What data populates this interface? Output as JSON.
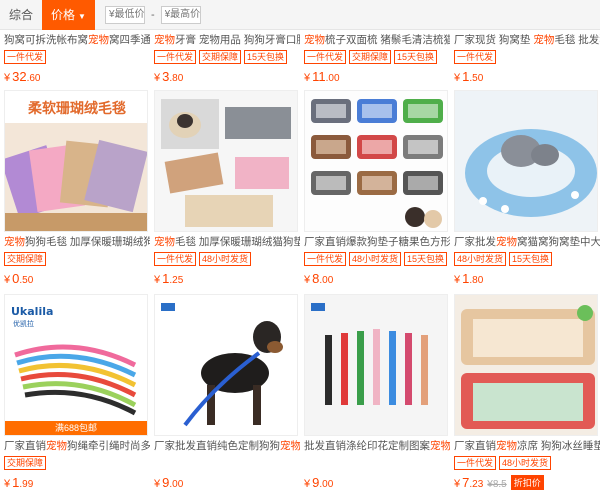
{
  "sortbar": {
    "comprehensive_label": "综合",
    "price_label": "价格",
    "price_arrow": "▼",
    "min_placeholder": "¥最低价",
    "max_placeholder": "¥最高价",
    "dash": "-"
  },
  "rows": [
    [
      {
        "title_pre": "狗窝可拆洗帐布窝",
        "title_hl": "宠物",
        "title_post": "窝四季通用厂家...",
        "tags": [
          "一件代发"
        ],
        "price_int": "32",
        "price_dec": ".60"
      },
      {
        "title_pre": "",
        "title_hl": "宠物",
        "title_post": "牙膏 宠物用品 狗狗牙膏口腔护...",
        "tags": [
          "一件代发",
          "交期保障",
          "15天包换"
        ],
        "price_int": "3",
        "price_dec": ".80"
      },
      {
        "title_pre": "",
        "title_hl": "宠物",
        "title_post": "梳子双面梳 猪鬃毛清洁梳猫狗...",
        "tags": [
          "一件代发",
          "交期保障",
          "15天包换"
        ],
        "price_int": "11",
        "price_dec": ".00"
      },
      {
        "title_pre": "厂家现货 狗窝垫 ",
        "title_hl": "宠物",
        "title_post": "毛毯 批发狗狗...",
        "tags": [
          "一件代发"
        ],
        "price_int": "1",
        "price_dec": ".50"
      }
    ],
    [
      {
        "title_pre": "",
        "title_hl": "宠物",
        "title_post": "狗狗毛毯 加厚保暖珊瑚绒狗窝...",
        "tags": [
          "交期保障"
        ],
        "price_int": "0",
        "price_dec": ".50",
        "image_text": "柔软珊瑚绒毛毯"
      },
      {
        "title_pre": "",
        "title_hl": "宠物",
        "title_post": "毛毯 加厚保暖珊瑚绒猫狗垫...",
        "tags": [
          "一件代发",
          "48小时发货"
        ],
        "price_int": "1",
        "price_dec": ".25"
      },
      {
        "title_pre": "厂家直销爆款狗垫子糖果色方形保暖...",
        "title_hl": "",
        "title_post": "",
        "tags": [
          "一件代发",
          "48小时发货",
          "15天包换"
        ],
        "price_int": "8",
        "price_dec": ".00"
      },
      {
        "title_pre": "厂家批发",
        "title_hl": "宠物",
        "title_post": "窝猫窝狗窝垫中大型犬...",
        "tags": [
          "48小时发货",
          "15天包换"
        ],
        "price_int": "1",
        "price_dec": ".80"
      }
    ],
    [
      {
        "title_pre": "厂家直销",
        "title_hl": "宠物",
        "title_post": "狗绳牵引绳时尚多色PU...",
        "tags": [
          "交期保障"
        ],
        "price_int": "1",
        "price_dec": ".99",
        "promo": "满688包邮",
        "brand": "Ukalila",
        "brand_sub": "优凯拉"
      },
      {
        "title_pre": "厂家批发直销纯色定制狗狗",
        "title_hl": "宠物用品",
        "title_post": "...",
        "tags": [],
        "price_int": "9",
        "price_dec": ".00"
      },
      {
        "title_pre": "批发直销涤纶印花定制图案",
        "title_hl": "宠物用品",
        "title_post": "...",
        "tags": [],
        "price_int": "9",
        "price_dec": ".00"
      },
      {
        "title_pre": "厂家直销",
        "title_hl": "宠物",
        "title_post": "凉席 狗狗冰丝睡垫猫凉...",
        "tags": [
          "一件代发",
          "48小时发货"
        ],
        "price_int": "7",
        "price_dec": ".23",
        "orig": "¥8.5",
        "badge": "折扣价"
      }
    ]
  ],
  "currency": "¥"
}
